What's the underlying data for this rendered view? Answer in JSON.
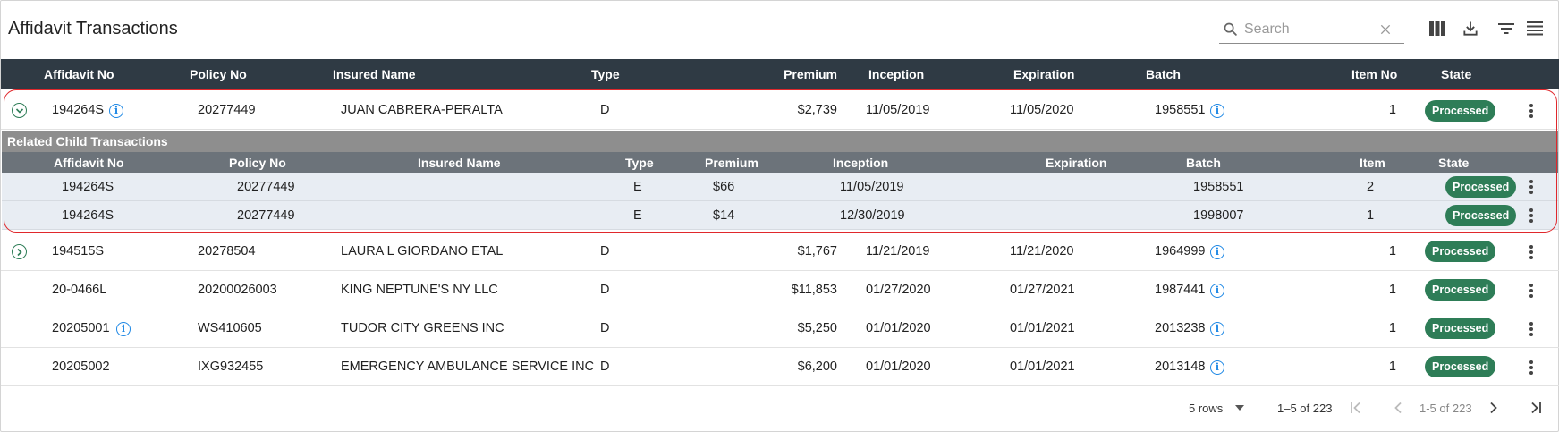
{
  "page": {
    "title": "Affidavit Transactions",
    "search_placeholder": "Search"
  },
  "colors": {
    "header_bg": "#2f3a44",
    "processed_badge": "#2e7d57",
    "info_icon": "#1e88e5",
    "highlight_border": "#e0282c",
    "child_row_bg": "#e8edf3"
  },
  "toolbar": {
    "icons": [
      "columns-icon",
      "download-icon",
      "filter-icon",
      "density-icon"
    ]
  },
  "table": {
    "columns": [
      "Affidavit No",
      "Policy No",
      "Insured Name",
      "Type",
      "Premium",
      "Inception",
      "Expiration",
      "Batch",
      "Item No",
      "State"
    ],
    "rows": [
      {
        "affidavit": "194264S",
        "policy": "20277449",
        "insured": "JUAN CABRERA-PERALTA",
        "type": "D",
        "premium": "$2,739",
        "inception": "11/05/2019",
        "expiration": "11/05/2020",
        "batch": "1958551",
        "item": "1",
        "state": "Processed"
      },
      {
        "affidavit": "194515S",
        "policy": "20278504",
        "insured": "LAURA L GIORDANO ETAL",
        "type": "D",
        "premium": "$1,767",
        "inception": "11/21/2019",
        "expiration": "11/21/2020",
        "batch": "1964999",
        "item": "1",
        "state": "Processed"
      },
      {
        "affidavit": "20-0466L",
        "policy": "20200026003",
        "insured": "KING NEPTUNE'S NY LLC",
        "type": "D",
        "premium": "$11,853",
        "inception": "01/27/2020",
        "expiration": "01/27/2021",
        "batch": "1987441",
        "item": "1",
        "state": "Processed"
      },
      {
        "affidavit": "20205001",
        "policy": "WS410605",
        "insured": "TUDOR CITY GREENS INC",
        "type": "D",
        "premium": "$5,250",
        "inception": "01/01/2020",
        "expiration": "01/01/2021",
        "batch": "2013238",
        "item": "1",
        "state": "Processed"
      },
      {
        "affidavit": "20205002",
        "policy": "IXG932455",
        "insured": "EMERGENCY AMBULANCE SERVICE INC",
        "type": "D",
        "premium": "$6,200",
        "inception": "01/01/2020",
        "expiration": "01/01/2021",
        "batch": "2013148",
        "item": "1",
        "state": "Processed"
      }
    ]
  },
  "child": {
    "title": "Related Child Transactions",
    "columns": [
      "Affidavit No",
      "Policy No",
      "Insured Name",
      "Type",
      "Premium",
      "Inception",
      "Expiration",
      "Batch",
      "Item",
      "State"
    ],
    "rows": [
      {
        "affidavit": "194264S",
        "policy": "20277449",
        "insured": "",
        "type": "E",
        "premium": "$66",
        "inception": "11/05/2019",
        "expiration": "",
        "batch": "1958551",
        "item": "2",
        "state": "Processed"
      },
      {
        "affidavit": "194264S",
        "policy": "20277449",
        "insured": "",
        "type": "E",
        "premium": "$14",
        "inception": "12/30/2019",
        "expiration": "",
        "batch": "1998007",
        "item": "1",
        "state": "Processed"
      }
    ]
  },
  "footer": {
    "rows_per_page": "5 rows",
    "range_label": "1–5 of 223",
    "page_label": "1-5 of 223"
  }
}
